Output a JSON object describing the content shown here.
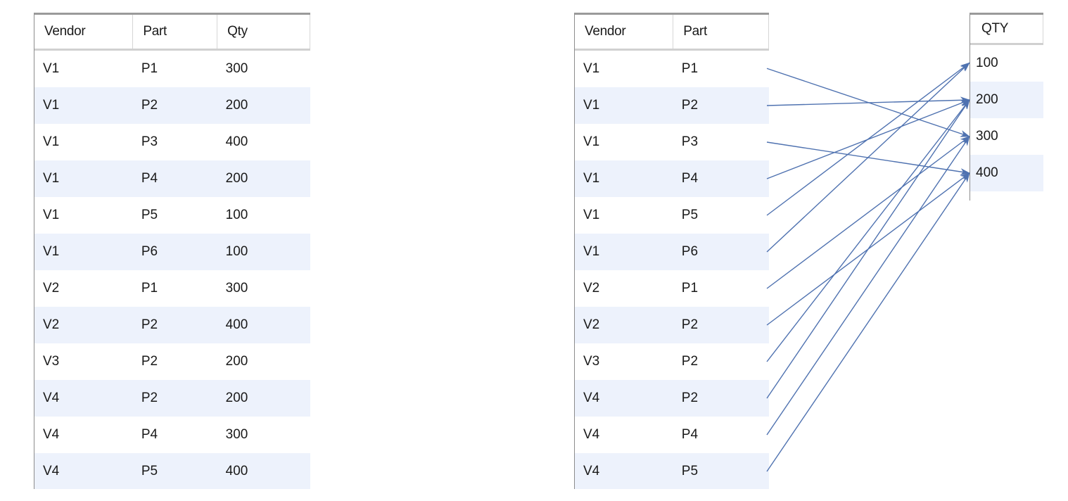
{
  "left_table": {
    "headers": [
      "Vendor",
      "Part",
      "Qty"
    ],
    "rows": [
      [
        "V1",
        "P1",
        "300"
      ],
      [
        "V1",
        "P2",
        "200"
      ],
      [
        "V1",
        "P3",
        "400"
      ],
      [
        "V1",
        "P4",
        "200"
      ],
      [
        "V1",
        "P5",
        "100"
      ],
      [
        "V1",
        "P6",
        "100"
      ],
      [
        "V2",
        "P1",
        "300"
      ],
      [
        "V2",
        "P2",
        "400"
      ],
      [
        "V3",
        "P2",
        "200"
      ],
      [
        "V4",
        "P2",
        "200"
      ],
      [
        "V4",
        "P4",
        "300"
      ],
      [
        "V4",
        "P5",
        "400"
      ]
    ]
  },
  "middle_table": {
    "headers": [
      "Vendor",
      "Part"
    ],
    "rows": [
      [
        "V1",
        "P1"
      ],
      [
        "V1",
        "P2"
      ],
      [
        "V1",
        "P3"
      ],
      [
        "V1",
        "P4"
      ],
      [
        "V1",
        "P5"
      ],
      [
        "V1",
        "P6"
      ],
      [
        "V2",
        "P1"
      ],
      [
        "V2",
        "P2"
      ],
      [
        "V3",
        "P2"
      ],
      [
        "V4",
        "P2"
      ],
      [
        "V4",
        "P4"
      ],
      [
        "V4",
        "P5"
      ]
    ]
  },
  "qty_table": {
    "headers": [
      "QTY"
    ],
    "rows": [
      [
        "100"
      ],
      [
        "200"
      ],
      [
        "300"
      ],
      [
        "400"
      ]
    ]
  },
  "mapping": {
    "arrow_color": "#4f72b0",
    "links": [
      {
        "from_row": 0,
        "to_value": "300"
      },
      {
        "from_row": 1,
        "to_value": "200"
      },
      {
        "from_row": 2,
        "to_value": "400"
      },
      {
        "from_row": 3,
        "to_value": "200"
      },
      {
        "from_row": 4,
        "to_value": "100"
      },
      {
        "from_row": 5,
        "to_value": "100"
      },
      {
        "from_row": 6,
        "to_value": "300"
      },
      {
        "from_row": 7,
        "to_value": "400"
      },
      {
        "from_row": 8,
        "to_value": "200"
      },
      {
        "from_row": 9,
        "to_value": "200"
      },
      {
        "from_row": 10,
        "to_value": "300"
      },
      {
        "from_row": 11,
        "to_value": "400"
      }
    ]
  }
}
